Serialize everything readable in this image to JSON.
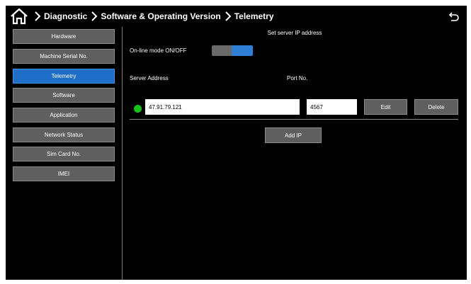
{
  "header": {
    "home_icon": "home-icon",
    "breadcrumb": [
      "Diagnostic",
      "Software & Operating Version",
      "Telemetry"
    ],
    "back_icon": "back-arrow-icon"
  },
  "sidebar": {
    "items": [
      {
        "label": "Hardware",
        "active": false
      },
      {
        "label": "Machine Serial No.",
        "active": false
      },
      {
        "label": "Telemetry",
        "active": true
      },
      {
        "label": "Software",
        "active": false
      },
      {
        "label": "Application",
        "active": false
      },
      {
        "label": "Network Status",
        "active": false
      },
      {
        "label": "Sim Card No.",
        "active": false
      },
      {
        "label": "IMEI",
        "active": false
      }
    ]
  },
  "main": {
    "title": "Set server IP address",
    "online_mode_label": "On-line mode ON/OFF",
    "online_mode_on": true,
    "server_address_label": "Server Address",
    "port_label": "Port No.",
    "server_row": {
      "status": "connected",
      "server_address": "47.91.79.121",
      "port": "4567",
      "edit_label": "Edit",
      "delete_label": "Delete"
    },
    "add_ip_label": "Add IP"
  },
  "colors": {
    "background": "#000000",
    "active_accent": "#1f6fc9",
    "button_gray": "#5f5f5f",
    "status_green": "#19c21a"
  }
}
